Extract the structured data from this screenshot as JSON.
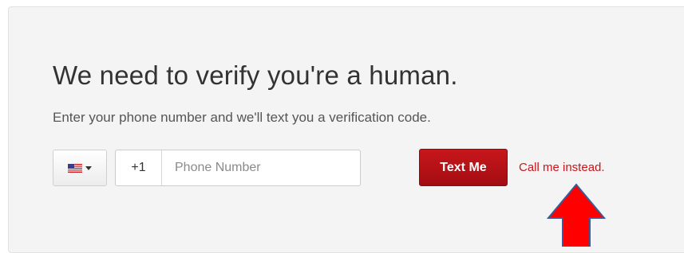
{
  "verification": {
    "heading": "We need to verify you're a human.",
    "subtext": "Enter your phone number and we'll text you a verification code.",
    "country_selector": {
      "flag_icon": "us-flag-icon",
      "caret_icon": "caret-down-icon"
    },
    "phone": {
      "prefix": "+1",
      "placeholder": "Phone Number",
      "value": ""
    },
    "text_me_label": "Text Me",
    "call_me_label": "Call me instead."
  },
  "annotation": {
    "icon": "up-arrow-icon",
    "fill_color": "#ff0000",
    "stroke_color": "#3a5a9a"
  },
  "colors": {
    "accent": "#c8161c",
    "card_background": "#f4f4f4"
  }
}
